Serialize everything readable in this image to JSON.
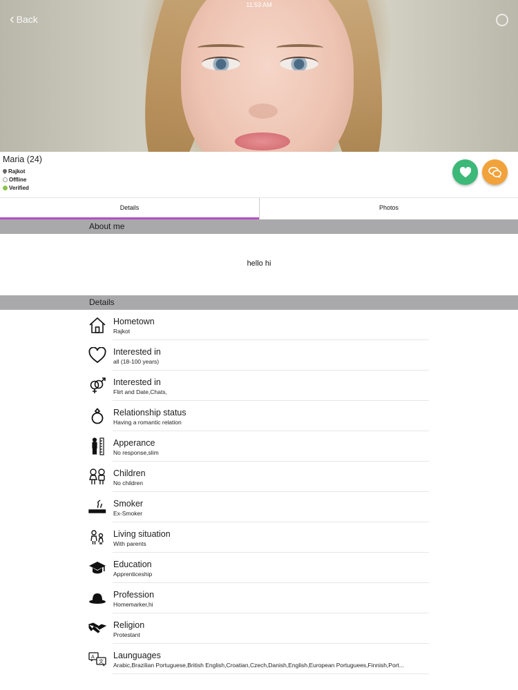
{
  "status_bar": {
    "time": "11:53 AM"
  },
  "nav": {
    "back_label": "Back"
  },
  "profile": {
    "name": "Maria (24)",
    "location": "Rajkot",
    "online_status": "Offline",
    "verified_label": "Verified"
  },
  "actions": {
    "like_icon": "heart-icon",
    "chat_icon": "chat-bubbles-icon",
    "like_color": "#3cb878",
    "chat_color": "#f2a23a"
  },
  "tabs": [
    {
      "label": "Details",
      "active": true
    },
    {
      "label": "Photos",
      "active": false
    }
  ],
  "accent_color": "#b44fc4",
  "about": {
    "header": "About me",
    "text": "hello hi"
  },
  "details": {
    "header": "Details",
    "items": [
      {
        "icon": "house-icon",
        "label": "Hometown",
        "value": "Rajkot"
      },
      {
        "icon": "heart-outline-icon",
        "label": "Interested in",
        "value": "all (18-100 years)"
      },
      {
        "icon": "gender-symbols-icon",
        "label": "Interested in",
        "value": "Flirt and Date,Chats,"
      },
      {
        "icon": "ring-icon",
        "label": "Relationship status",
        "value": "Having a romantic relation"
      },
      {
        "icon": "height-person-icon",
        "label": "Apperance",
        "value": "No response,slim"
      },
      {
        "icon": "children-icon",
        "label": "Children",
        "value": "No children"
      },
      {
        "icon": "cigarette-icon",
        "label": "Smoker",
        "value": "Ex-Smoker"
      },
      {
        "icon": "family-icon",
        "label": "Living situation",
        "value": "With parents"
      },
      {
        "icon": "graduation-cap-icon",
        "label": "Education",
        "value": "Apprenticeship"
      },
      {
        "icon": "hat-icon",
        "label": "Profession",
        "value": "Homemarker,hi"
      },
      {
        "icon": "handshake-icon",
        "label": "Religion",
        "value": "Protestant"
      },
      {
        "icon": "translate-icon",
        "label": "Launguages",
        "value": "Arabic,Brazilian Portuguese,British English,Croatian,Czech,Danish,English,European Portuguees,Finnish,Port..."
      }
    ]
  }
}
